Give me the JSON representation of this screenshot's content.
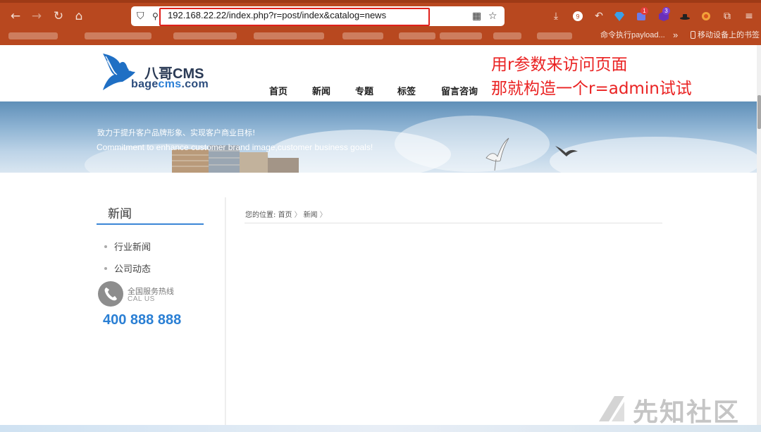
{
  "browser": {
    "url": "192.168.22.22/index.php?r=post/index&catalog=news",
    "bookmark_overflow": "»",
    "mobile_bookmarks": "移动设备上的书签",
    "bookmark_partial": "命令执行payload...",
    "extension_badges": [
      "9",
      "1",
      "3"
    ],
    "icons": [
      "back-arrow-icon",
      "forward-arrow-icon",
      "reload-icon",
      "home-icon",
      "shield-icon",
      "qr-code-icon",
      "star-icon",
      "download-icon",
      "menu-icon"
    ],
    "accent_color": "#b8481f"
  },
  "site": {
    "logo_title": "八哥CMS",
    "logo_sub_prefix": "bage",
    "logo_sub_brand": "cms",
    "logo_sub_suffix": ".com",
    "nav": [
      "首页",
      "新闻",
      "专题",
      "标签",
      "留言咨询"
    ],
    "banner_line1": "致力于提升客户品牌形象、实现客户商业目标!",
    "banner_line2": "Commitment to enhance customer brand image,customer business goals!",
    "sidebar": {
      "title": "新闻",
      "items": [
        "行业新闻",
        "公司动态"
      ],
      "hotline_cn": "全国服务热线",
      "hotline_en": "CAL US",
      "phone": "400 888 888"
    },
    "breadcrumb": {
      "prefix": "您的位置:",
      "home": "首页",
      "current": "新闻",
      "sep": "〉"
    }
  },
  "annotation": {
    "line1": "用r参数来访问页面",
    "line2": "那就构造一个r=admin试试"
  },
  "watermark": "先知社区"
}
